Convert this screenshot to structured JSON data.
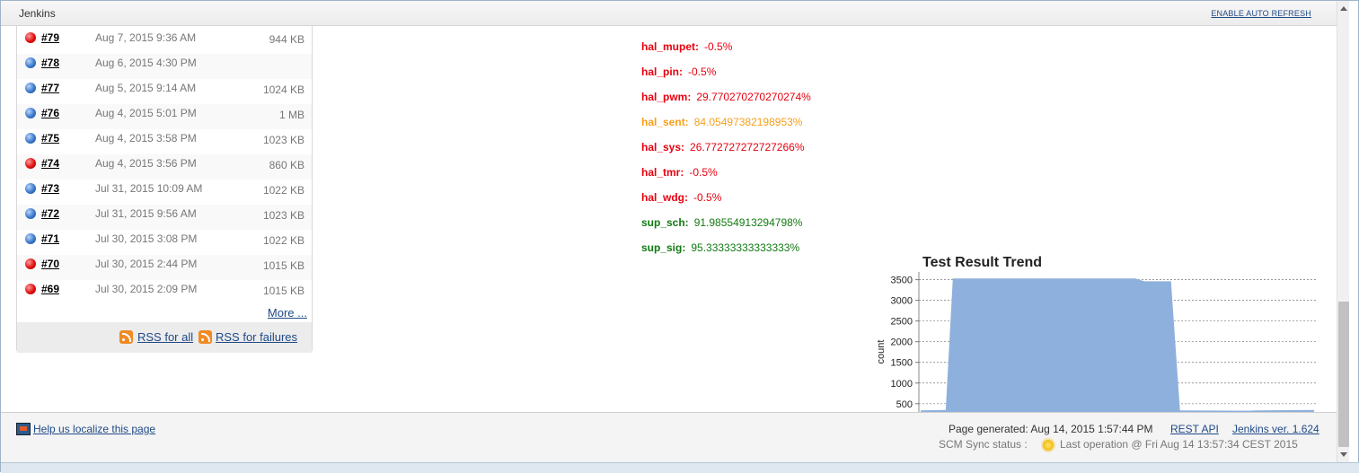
{
  "header": {
    "title": "Jenkins",
    "auto_refresh_label": "ENABLE AUTO REFRESH"
  },
  "build_history": {
    "builds": [
      {
        "number": "#79",
        "date": "Aug 7, 2015 9:36 AM",
        "size": "944 KB",
        "status": "failed"
      },
      {
        "number": "#78",
        "date": "Aug 6, 2015 4:30 PM",
        "size": "",
        "status": "success"
      },
      {
        "number": "#77",
        "date": "Aug 5, 2015 9:14 AM",
        "size": "1024 KB",
        "status": "success"
      },
      {
        "number": "#76",
        "date": "Aug 4, 2015 5:01 PM",
        "size": "1 MB",
        "status": "success"
      },
      {
        "number": "#75",
        "date": "Aug 4, 2015 3:58 PM",
        "size": "1023 KB",
        "status": "success"
      },
      {
        "number": "#74",
        "date": "Aug 4, 2015 3:56 PM",
        "size": "860 KB",
        "status": "failed"
      },
      {
        "number": "#73",
        "date": "Jul 31, 2015 10:09 AM",
        "size": "1022 KB",
        "status": "success"
      },
      {
        "number": "#72",
        "date": "Jul 31, 2015 9:56 AM",
        "size": "1023 KB",
        "status": "success"
      },
      {
        "number": "#71",
        "date": "Jul 30, 2015 3:08 PM",
        "size": "1022 KB",
        "status": "success"
      },
      {
        "number": "#70",
        "date": "Jul 30, 2015 2:44 PM",
        "size": "1015 KB",
        "status": "failed"
      },
      {
        "number": "#69",
        "date": "Jul 30, 2015 2:09 PM",
        "size": "1015 KB",
        "status": "failed"
      }
    ],
    "more_label": "More ...",
    "rss_all_label": "RSS for all",
    "rss_failures_label": "RSS for failures"
  },
  "coverage": [
    {
      "key": "hal_mupet:",
      "value": "-0.5%",
      "color": "#e8000f"
    },
    {
      "key": "hal_pin:",
      "value": "-0.5%",
      "color": "#e8000f"
    },
    {
      "key": "hal_pwm:",
      "value": "29.770270270270274%",
      "color": "#e8000f"
    },
    {
      "key": "hal_sent:",
      "value": "84.05497382198953%",
      "color": "#f7a01b"
    },
    {
      "key": "hal_sys:",
      "value": "26.772727272727266%",
      "color": "#e8000f"
    },
    {
      "key": "hal_tmr:",
      "value": "-0.5%",
      "color": "#e8000f"
    },
    {
      "key": "hal_wdg:",
      "value": "-0.5%",
      "color": "#e8000f"
    },
    {
      "key": "sup_sch:",
      "value": "91.98554913294798%",
      "color": "#127a12"
    },
    {
      "key": "sup_sig:",
      "value": "95.33333333333333%",
      "color": "#127a12"
    }
  ],
  "chart_data": {
    "type": "area",
    "title": "Test Result Trend",
    "ylabel": "count",
    "xlabel": "",
    "yticks": [
      500,
      1000,
      1500,
      2000,
      2500,
      3000,
      3500
    ],
    "ylim": [
      300,
      3600
    ],
    "grid": true,
    "fill_color": "#8eb0dc",
    "x": [
      0,
      1,
      2,
      3,
      4,
      5,
      6,
      7,
      8,
      9,
      10,
      11
    ],
    "values": [
      340,
      350,
      3530,
      3530,
      3530,
      3530,
      3530,
      3460,
      340,
      330,
      340,
      350
    ]
  },
  "footer": {
    "localize_label": "Help us localize this page",
    "generated_label": "Page generated: Aug 14, 2015 1:57:44 PM",
    "rest_api_label": "REST API",
    "version_label": "Jenkins ver. 1.624",
    "scm_label": "SCM Sync status :",
    "scm_value": "Last operation @ Fri Aug 14 13:57:34 CEST 2015"
  }
}
